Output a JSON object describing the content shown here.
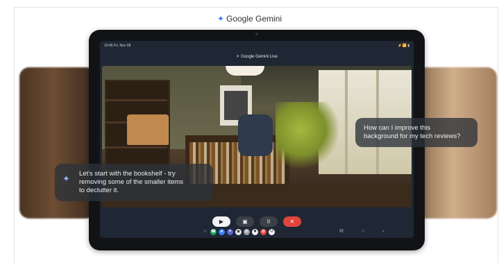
{
  "header": {
    "brand_icon": "gemini-spark-icon",
    "brand": "Google Gemini"
  },
  "tablet": {
    "status_time": "10:45 Fri, Nov 08",
    "status_icons": "⚡📶 ▮",
    "app_title": "Google Gemini Live",
    "user_message": [
      "How can I improve this",
      "background for my tech reviews?"
    ],
    "gemini_message": [
      "Let's start with the bookshelf - try",
      "removing some of the smaller items",
      "to declutter it."
    ],
    "controls": {
      "camera_icon": "video-camera-icon",
      "screenshare_icon": "screen-share-icon",
      "pause_label": "II",
      "end_label": "✕"
    },
    "dock_apps": [
      {
        "name": "grid",
        "color": "#6b7280",
        "glyph": "∷"
      },
      {
        "name": "phone",
        "color": "#19a463",
        "glyph": "☎"
      },
      {
        "name": "messages",
        "color": "#3b82f6",
        "glyph": "●"
      },
      {
        "name": "gemini",
        "color": "#5b5fd6",
        "glyph": "✦"
      },
      {
        "name": "camera",
        "color": "#e5e7eb",
        "glyph": "◉"
      },
      {
        "name": "settings",
        "color": "#9ca3af",
        "glyph": "⚙"
      },
      {
        "name": "photos",
        "color": "#f3f4f6",
        "glyph": "✸"
      },
      {
        "name": "chrome",
        "color": "#ea4335",
        "glyph": "◍"
      },
      {
        "name": "gmail",
        "color": "#ffffff",
        "glyph": "M"
      }
    ],
    "nav": [
      "III",
      "○",
      "‹"
    ]
  }
}
